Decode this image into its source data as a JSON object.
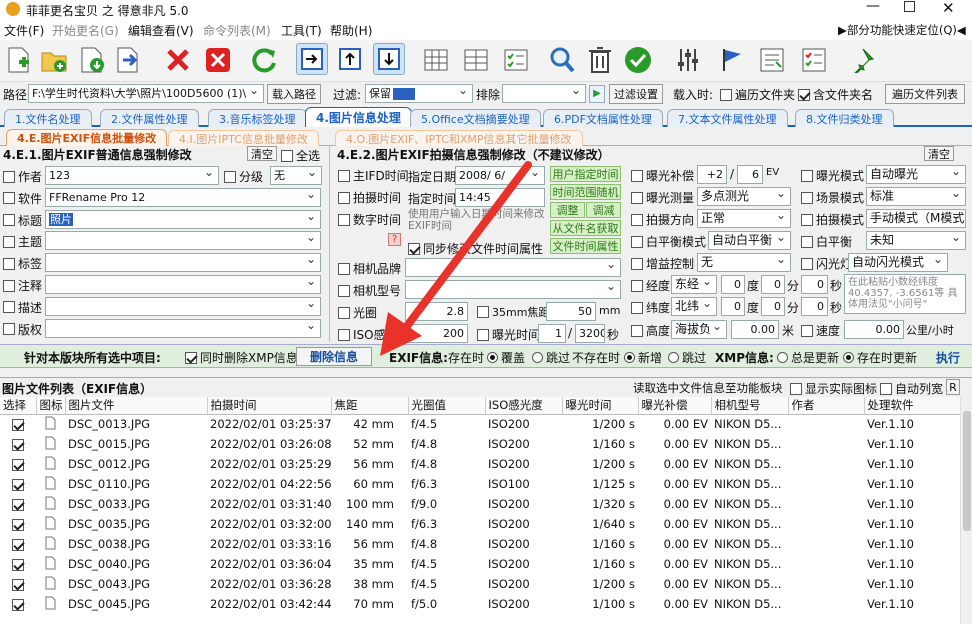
{
  "window": {
    "title": "菲菲更名宝贝 之 得意非凡 5.0"
  },
  "menu": {
    "items": [
      "文件(F)",
      "开始更名(G)",
      "编辑查看(V)",
      "命令列表(M)",
      "工具(T)",
      "帮助(H)"
    ],
    "quick": "▶部分功能快速定位(Q)◀"
  },
  "pathbar": {
    "path_label": "路径",
    "path_value": "F:\\学生时代资料\\大学\\照片\\100D5600 (1)\\",
    "load_btn": "载入路径",
    "filter_label": "过滤:",
    "filter_keep": "保留",
    "exclude_label": "排除",
    "filter_settings": "过滤设置",
    "load_time_label": "载入时:",
    "traverse_folder": "遍历文件夹",
    "include_folder": "含文件夹名",
    "traverse_list": "遍历文件列表"
  },
  "tabs": [
    "1.文件名处理",
    "2.文件属性处理",
    "3.音乐标签处理",
    "4.图片信息处理",
    "5.Office文档摘要处理",
    "6.PDF文档属性处理",
    "7.文本文件属性处理",
    "8.文件归类处理"
  ],
  "subtabs": [
    "4.E.图片EXIF信息批量修改",
    "4.I.图片IPTC信息批量修改",
    "4.O.图片EXIF、IPTC和XMP信息其它批量修改"
  ],
  "left": {
    "title": "4.E.1.图片EXIF普通信息强制修改",
    "clear": "清空",
    "select_all": "全选",
    "fields": [
      {
        "label": "作者",
        "value": "123"
      },
      {
        "label": "软件",
        "value": "FFRename Pro 12"
      },
      {
        "label": "标题",
        "value": "照片"
      },
      {
        "label": "主题",
        "value": ""
      },
      {
        "label": "标签",
        "value": ""
      },
      {
        "label": "注释",
        "value": ""
      },
      {
        "label": "描述",
        "value": ""
      },
      {
        "label": "版权",
        "value": ""
      }
    ],
    "rating_label": "分级",
    "rating_value": "无"
  },
  "mid": {
    "title": "4.E.2.图片EXIF拍摄信息强制修改（不建议修改）",
    "main_ifd": "主IFD时间",
    "shoot_time": "拍摄时间",
    "digital_time": "数字时间",
    "specify_date": "指定日期",
    "date_value": "2008/ 6/",
    "specify_time": "指定时间",
    "time_value": "14:45",
    "hint": "使用用户输入日期时间来修改EXIF时间",
    "sync": "同步修改文件时间属性",
    "btn_user": "用户指定时间",
    "btn_random": "时间范围随机",
    "btn_adjust1": "调整",
    "btn_adjust2": "调减",
    "btn_from_name": "从文件名获取",
    "btn_file_time": "文件时间属性",
    "camera_brand": "相机品牌",
    "camera_model": "相机型号",
    "aperture": "光圈",
    "aperture_val": "2.8",
    "focal35": "35mm焦距",
    "focal35_val": "50",
    "focal_unit": "mm",
    "iso": "ISO感光度",
    "iso_val": "200",
    "exposure_time": "曝光时间",
    "exp_num": "1",
    "exp_den": "3200",
    "exp_unit": "秒"
  },
  "right": {
    "clear": "清空",
    "exp_comp": "曝光补偿",
    "ec_num": "+2",
    "ec_den": "6",
    "ec_unit": "EV",
    "exp_mode": "曝光模式",
    "exp_mode_val": "自动曝光",
    "metering": "曝光测量",
    "metering_val": "多点测光",
    "scene": "场景模式",
    "scene_val": "标准",
    "direction": "拍摄方向",
    "direction_val": "正常",
    "shoot_mode": "拍摄模式",
    "shoot_mode_val": "手动模式（M模式）",
    "wb": "白平衡模式",
    "wb_val": "自动白平衡",
    "wb2": "白平衡",
    "wb2_val": "未知",
    "gain": "增益控制",
    "gain_val": "无",
    "flash": "闪光灯",
    "flash_val": "自动闪光模式",
    "lon": "经度",
    "lon_dir": "东经",
    "lat": "纬度",
    "lat_dir": "北纬",
    "deg": "度",
    "min": "分",
    "sec": "秒",
    "zero": "0",
    "alt": "高度",
    "alt_dir": "海拔负",
    "alt_val": "0.00",
    "alt_unit": "米",
    "speed": "速度",
    "speed_val": "0.00",
    "speed_unit": "公里/小时",
    "hint": "在此粘贴小数经纬度 40.4357, -3.6561等 具体用法见\"小问号\""
  },
  "action": {
    "label": "针对本版块所有选中项目:",
    "del_xmp": "同时删除XMP信息",
    "delete_btn": "删除信息",
    "exif_label": "EXIF信息:",
    "exists": "存在时",
    "overwrite": "覆盖",
    "skip": "跳过",
    "not_exists": "不存在时",
    "add": "新增",
    "skip2": "跳过",
    "xmp_label": "XMP信息:",
    "always": "总是更新",
    "when_exists": "存在时更新",
    "execute": "执行"
  },
  "list": {
    "title": "图片文件列表（EXIF信息）",
    "read_btn": "读取选中文件信息至功能板块",
    "show_icon": "显示实际图标",
    "auto_list": "自动列宽",
    "r_btn": "R",
    "columns": [
      "选择",
      "图标",
      "图片文件",
      "拍摄时间",
      "焦距",
      "光圈值",
      "ISO感光度",
      "曝光时间",
      "曝光补偿",
      "相机型号",
      "作者",
      "处理软件"
    ],
    "rows": [
      [
        "DSC_0013.JPG",
        "2022/02/01 03:25:37",
        "42 mm",
        "f/4.5",
        "ISO200",
        "1/200 s",
        "0.00 EV",
        "NIKON D5...",
        "",
        "Ver.1.10"
      ],
      [
        "DSC_0015.JPG",
        "2022/02/01 03:26:08",
        "52 mm",
        "f/4.8",
        "ISO200",
        "1/160 s",
        "0.00 EV",
        "NIKON D5...",
        "",
        "Ver.1.10"
      ],
      [
        "DSC_0012.JPG",
        "2022/02/01 03:25:29",
        "56 mm",
        "f/4.8",
        "ISO200",
        "1/200 s",
        "0.00 EV",
        "NIKON D5...",
        "",
        "Ver.1.10"
      ],
      [
        "DSC_0110.JPG",
        "2022/02/01 04:22:56",
        "60 mm",
        "f/6.3",
        "ISO100",
        "1/125 s",
        "0.00 EV",
        "NIKON D5...",
        "",
        "Ver.1.10"
      ],
      [
        "DSC_0033.JPG",
        "2022/02/01 03:31:40",
        "100 mm",
        "f/9.0",
        "ISO200",
        "1/320 s",
        "0.00 EV",
        "NIKON D5...",
        "",
        "Ver.1.10"
      ],
      [
        "DSC_0035.JPG",
        "2022/02/01 03:32:00",
        "140 mm",
        "f/6.3",
        "ISO200",
        "1/640 s",
        "0.00 EV",
        "NIKON D5...",
        "",
        "Ver.1.10"
      ],
      [
        "DSC_0038.JPG",
        "2022/02/01 03:33:16",
        "56 mm",
        "f/4.8",
        "ISO200",
        "1/160 s",
        "0.00 EV",
        "NIKON D5...",
        "",
        "Ver.1.10"
      ],
      [
        "DSC_0040.JPG",
        "2022/02/01 03:36:04",
        "35 mm",
        "f/4.5",
        "ISO200",
        "1/160 s",
        "0.00 EV",
        "NIKON D5...",
        "",
        "Ver.1.10"
      ],
      [
        "DSC_0043.JPG",
        "2022/02/01 03:36:28",
        "38 mm",
        "f/4.5",
        "ISO200",
        "1/200 s",
        "0.00 EV",
        "NIKON D5...",
        "",
        "Ver.1.10"
      ],
      [
        "DSC_0045.JPG",
        "2022/02/01 03:42:44",
        "70 mm",
        "f/5.0",
        "ISO200",
        "1/100 s",
        "0.00 EV",
        "NIKON D5...",
        "",
        "Ver.1.10"
      ]
    ]
  },
  "colors": {
    "arrow": "#e8322a",
    "tab_active": "#1b62c4",
    "accent_green": "#2d7a16"
  }
}
